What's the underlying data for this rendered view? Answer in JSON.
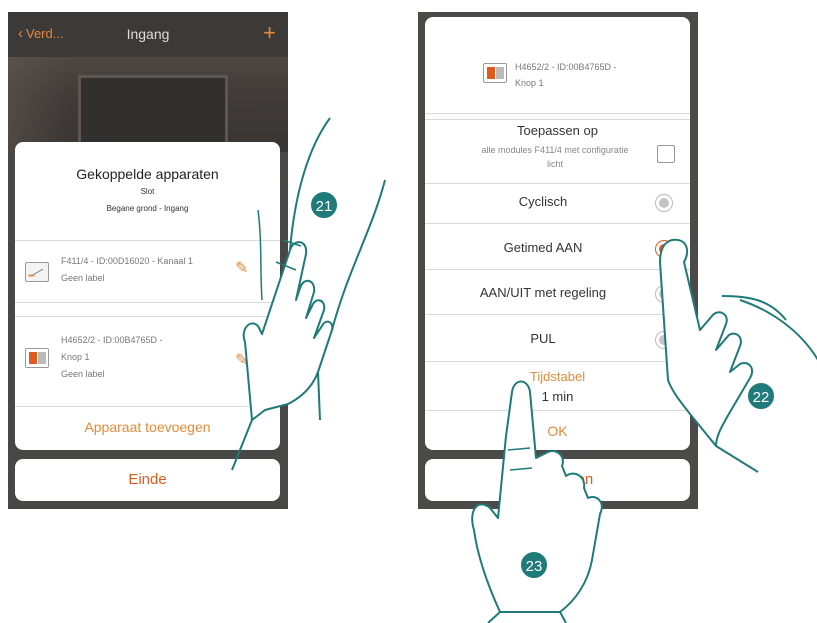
{
  "phone1": {
    "header": {
      "back_label": "Verd...",
      "title": "Ingang",
      "plus_label": "+"
    },
    "card": {
      "title": "Gekoppelde apparaten",
      "subtitle": "Slot",
      "location": "Begane grond - Ingang",
      "devices": [
        {
          "line1": "F411/4 - ID:00D16020 - Kanaal 1",
          "line2": "Geen label",
          "icon": "switch-module-icon"
        },
        {
          "line1": "H4652/2 - ID:00B4765D -",
          "line2": "Knop 1",
          "line3": "Geen label",
          "icon": "dual-button-icon"
        }
      ],
      "add_label": "Apparaat toevoegen"
    },
    "end_label": "Einde"
  },
  "phone2": {
    "device": {
      "line1": "H4652/2 - ID:00B4765D -",
      "line2": "Knop 1"
    },
    "apply": {
      "title": "Toepassen op",
      "subtitle_line1": "alle modules F411/4 met configuratie",
      "subtitle_line2": "licht",
      "checked": false
    },
    "options": [
      {
        "label": "Cyclisch",
        "selected": false
      },
      {
        "label": "Getimed AAN",
        "selected": true
      },
      {
        "label": "AAN/UIT met regeling",
        "selected": false
      },
      {
        "label": "PUL",
        "selected": false
      }
    ],
    "timetable": {
      "label": "Tijdstabel",
      "value": "1 min"
    },
    "ok_label": "OK",
    "cancel_label": "leren"
  },
  "annotations": {
    "badge21": "21",
    "badge22": "22",
    "badge23": "23"
  },
  "colors": {
    "accent": "#e48a3a",
    "accent_strong": "#e25a1c",
    "badge": "#1f7a7a",
    "backdrop": "#4b4a48"
  }
}
